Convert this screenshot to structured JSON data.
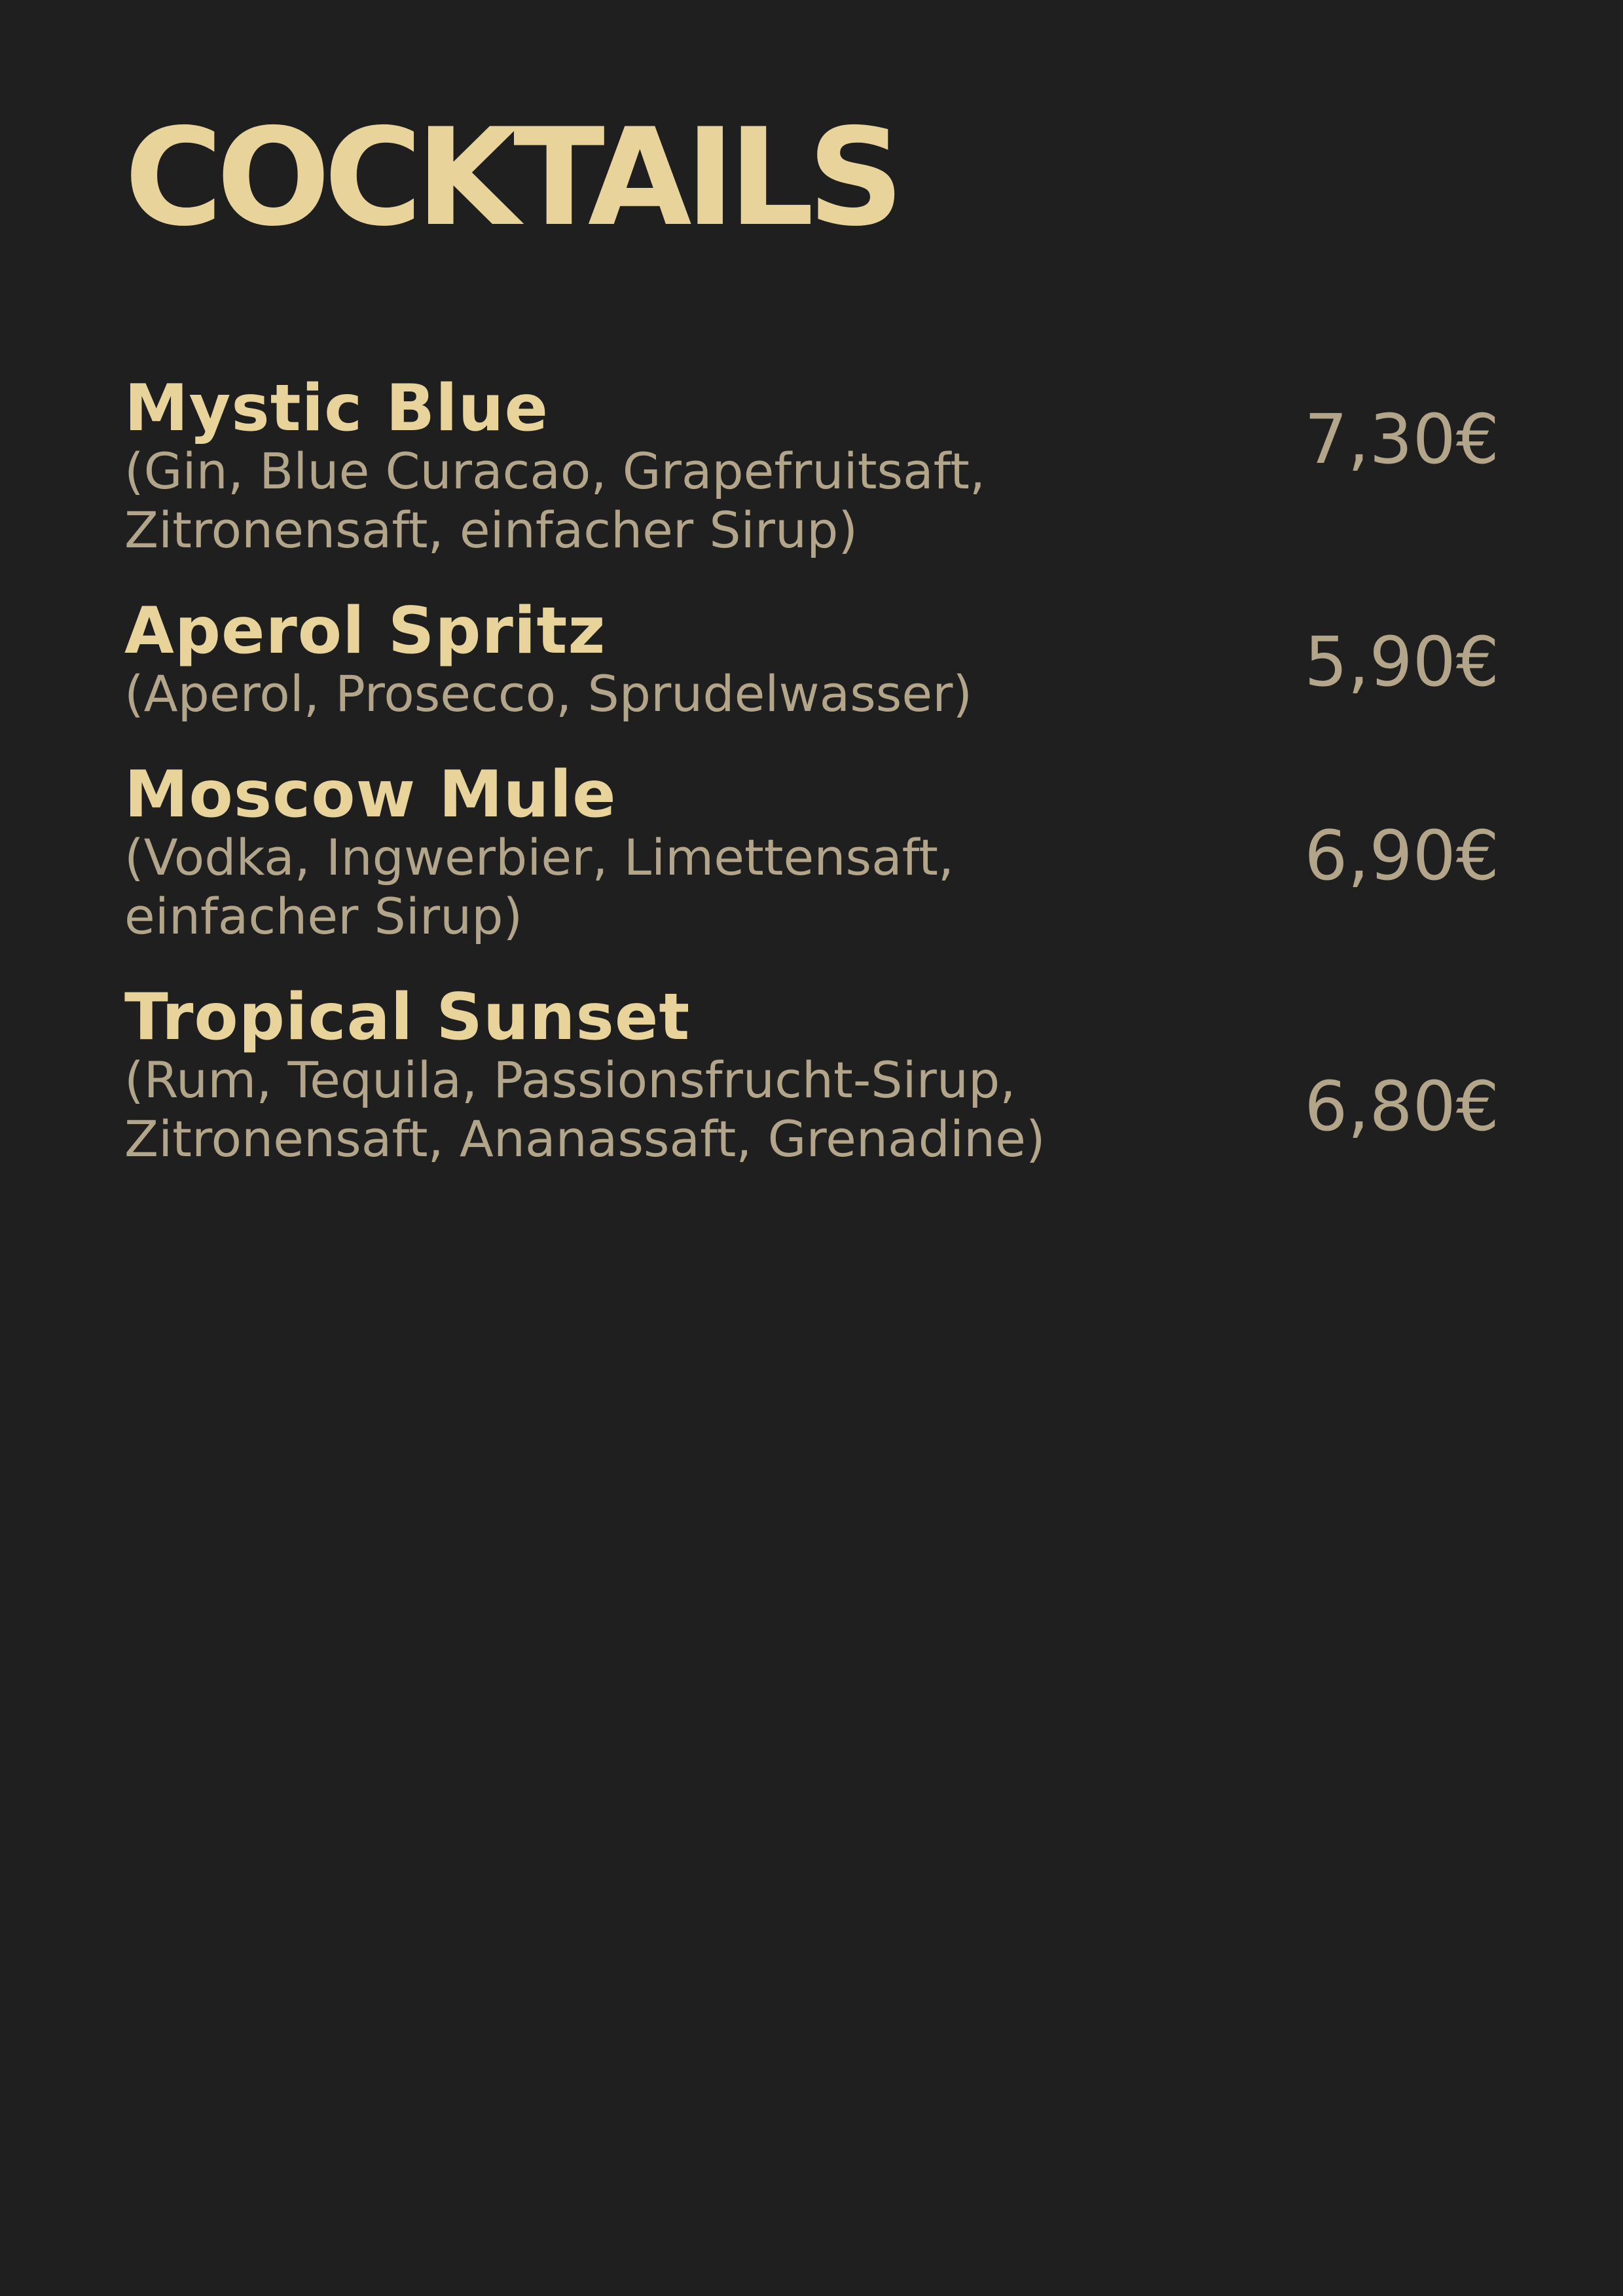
{
  "menu": {
    "title": "COCKTAILS",
    "items": [
      {
        "name": "Mystic Blue",
        "description": "(Gin, Blue Curacao, Grapefruitsaft, Zitronensaft, einfacher Sirup)",
        "price": "7,30€"
      },
      {
        "name": "Aperol Spritz",
        "description": "(Aperol, Prosecco, Sprudelwasser)",
        "price": "5,90€"
      },
      {
        "name": "Moscow Mule",
        "description": "(Vodka, Ingwerbier, Limettensaft, einfacher Sirup)",
        "price": "6,90€"
      },
      {
        "name": "Tropical Sunset",
        "description": "(Rum, Tequila, Passionsfrucht-Sirup, Zitronensaft, Ananassaft, Grenadine)",
        "price": "6,80€"
      }
    ]
  },
  "colors": {
    "background": "#1f1f1f",
    "heading": "#e8d49b",
    "body_text": "#b3a58a"
  }
}
